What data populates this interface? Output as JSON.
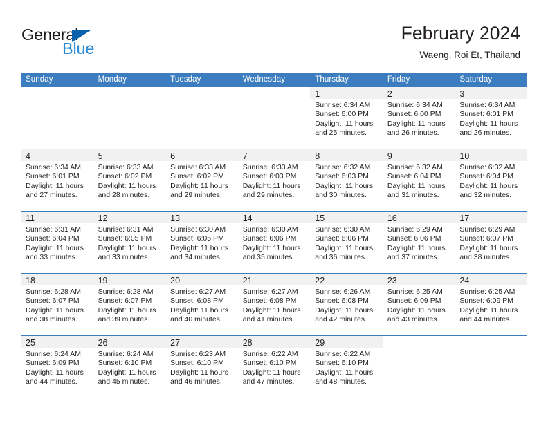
{
  "brand": {
    "name_top": "General",
    "name_bottom": "Blue",
    "triangle_color": "#0b63ad",
    "blue_color": "#2b8bd4"
  },
  "header": {
    "title": "February 2024",
    "subtitle": "Waeng, Roi Et, Thailand"
  },
  "theme": {
    "header_blue": "#3b7dbf",
    "daynum_band": "#f1f1f1",
    "text": "#231f20"
  },
  "calendar": {
    "weekday_headers": [
      "Sunday",
      "Monday",
      "Tuesday",
      "Wednesday",
      "Thursday",
      "Friday",
      "Saturday"
    ],
    "weeks": [
      [
        {
          "day": "",
          "lines": []
        },
        {
          "day": "",
          "lines": []
        },
        {
          "day": "",
          "lines": []
        },
        {
          "day": "",
          "lines": []
        },
        {
          "day": "1",
          "lines": [
            "Sunrise: 6:34 AM",
            "Sunset: 6:00 PM",
            "Daylight: 11 hours",
            "and 25 minutes."
          ]
        },
        {
          "day": "2",
          "lines": [
            "Sunrise: 6:34 AM",
            "Sunset: 6:00 PM",
            "Daylight: 11 hours",
            "and 26 minutes."
          ]
        },
        {
          "day": "3",
          "lines": [
            "Sunrise: 6:34 AM",
            "Sunset: 6:01 PM",
            "Daylight: 11 hours",
            "and 26 minutes."
          ]
        }
      ],
      [
        {
          "day": "4",
          "lines": [
            "Sunrise: 6:34 AM",
            "Sunset: 6:01 PM",
            "Daylight: 11 hours",
            "and 27 minutes."
          ]
        },
        {
          "day": "5",
          "lines": [
            "Sunrise: 6:33 AM",
            "Sunset: 6:02 PM",
            "Daylight: 11 hours",
            "and 28 minutes."
          ]
        },
        {
          "day": "6",
          "lines": [
            "Sunrise: 6:33 AM",
            "Sunset: 6:02 PM",
            "Daylight: 11 hours",
            "and 29 minutes."
          ]
        },
        {
          "day": "7",
          "lines": [
            "Sunrise: 6:33 AM",
            "Sunset: 6:03 PM",
            "Daylight: 11 hours",
            "and 29 minutes."
          ]
        },
        {
          "day": "8",
          "lines": [
            "Sunrise: 6:32 AM",
            "Sunset: 6:03 PM",
            "Daylight: 11 hours",
            "and 30 minutes."
          ]
        },
        {
          "day": "9",
          "lines": [
            "Sunrise: 6:32 AM",
            "Sunset: 6:04 PM",
            "Daylight: 11 hours",
            "and 31 minutes."
          ]
        },
        {
          "day": "10",
          "lines": [
            "Sunrise: 6:32 AM",
            "Sunset: 6:04 PM",
            "Daylight: 11 hours",
            "and 32 minutes."
          ]
        }
      ],
      [
        {
          "day": "11",
          "lines": [
            "Sunrise: 6:31 AM",
            "Sunset: 6:04 PM",
            "Daylight: 11 hours",
            "and 33 minutes."
          ]
        },
        {
          "day": "12",
          "lines": [
            "Sunrise: 6:31 AM",
            "Sunset: 6:05 PM",
            "Daylight: 11 hours",
            "and 33 minutes."
          ]
        },
        {
          "day": "13",
          "lines": [
            "Sunrise: 6:30 AM",
            "Sunset: 6:05 PM",
            "Daylight: 11 hours",
            "and 34 minutes."
          ]
        },
        {
          "day": "14",
          "lines": [
            "Sunrise: 6:30 AM",
            "Sunset: 6:06 PM",
            "Daylight: 11 hours",
            "and 35 minutes."
          ]
        },
        {
          "day": "15",
          "lines": [
            "Sunrise: 6:30 AM",
            "Sunset: 6:06 PM",
            "Daylight: 11 hours",
            "and 36 minutes."
          ]
        },
        {
          "day": "16",
          "lines": [
            "Sunrise: 6:29 AM",
            "Sunset: 6:06 PM",
            "Daylight: 11 hours",
            "and 37 minutes."
          ]
        },
        {
          "day": "17",
          "lines": [
            "Sunrise: 6:29 AM",
            "Sunset: 6:07 PM",
            "Daylight: 11 hours",
            "and 38 minutes."
          ]
        }
      ],
      [
        {
          "day": "18",
          "lines": [
            "Sunrise: 6:28 AM",
            "Sunset: 6:07 PM",
            "Daylight: 11 hours",
            "and 38 minutes."
          ]
        },
        {
          "day": "19",
          "lines": [
            "Sunrise: 6:28 AM",
            "Sunset: 6:07 PM",
            "Daylight: 11 hours",
            "and 39 minutes."
          ]
        },
        {
          "day": "20",
          "lines": [
            "Sunrise: 6:27 AM",
            "Sunset: 6:08 PM",
            "Daylight: 11 hours",
            "and 40 minutes."
          ]
        },
        {
          "day": "21",
          "lines": [
            "Sunrise: 6:27 AM",
            "Sunset: 6:08 PM",
            "Daylight: 11 hours",
            "and 41 minutes."
          ]
        },
        {
          "day": "22",
          "lines": [
            "Sunrise: 6:26 AM",
            "Sunset: 6:08 PM",
            "Daylight: 11 hours",
            "and 42 minutes."
          ]
        },
        {
          "day": "23",
          "lines": [
            "Sunrise: 6:25 AM",
            "Sunset: 6:09 PM",
            "Daylight: 11 hours",
            "and 43 minutes."
          ]
        },
        {
          "day": "24",
          "lines": [
            "Sunrise: 6:25 AM",
            "Sunset: 6:09 PM",
            "Daylight: 11 hours",
            "and 44 minutes."
          ]
        }
      ],
      [
        {
          "day": "25",
          "lines": [
            "Sunrise: 6:24 AM",
            "Sunset: 6:09 PM",
            "Daylight: 11 hours",
            "and 44 minutes."
          ]
        },
        {
          "day": "26",
          "lines": [
            "Sunrise: 6:24 AM",
            "Sunset: 6:10 PM",
            "Daylight: 11 hours",
            "and 45 minutes."
          ]
        },
        {
          "day": "27",
          "lines": [
            "Sunrise: 6:23 AM",
            "Sunset: 6:10 PM",
            "Daylight: 11 hours",
            "and 46 minutes."
          ]
        },
        {
          "day": "28",
          "lines": [
            "Sunrise: 6:22 AM",
            "Sunset: 6:10 PM",
            "Daylight: 11 hours",
            "and 47 minutes."
          ]
        },
        {
          "day": "29",
          "lines": [
            "Sunrise: 6:22 AM",
            "Sunset: 6:10 PM",
            "Daylight: 11 hours",
            "and 48 minutes."
          ]
        },
        {
          "day": "",
          "lines": []
        },
        {
          "day": "",
          "lines": []
        }
      ]
    ]
  }
}
